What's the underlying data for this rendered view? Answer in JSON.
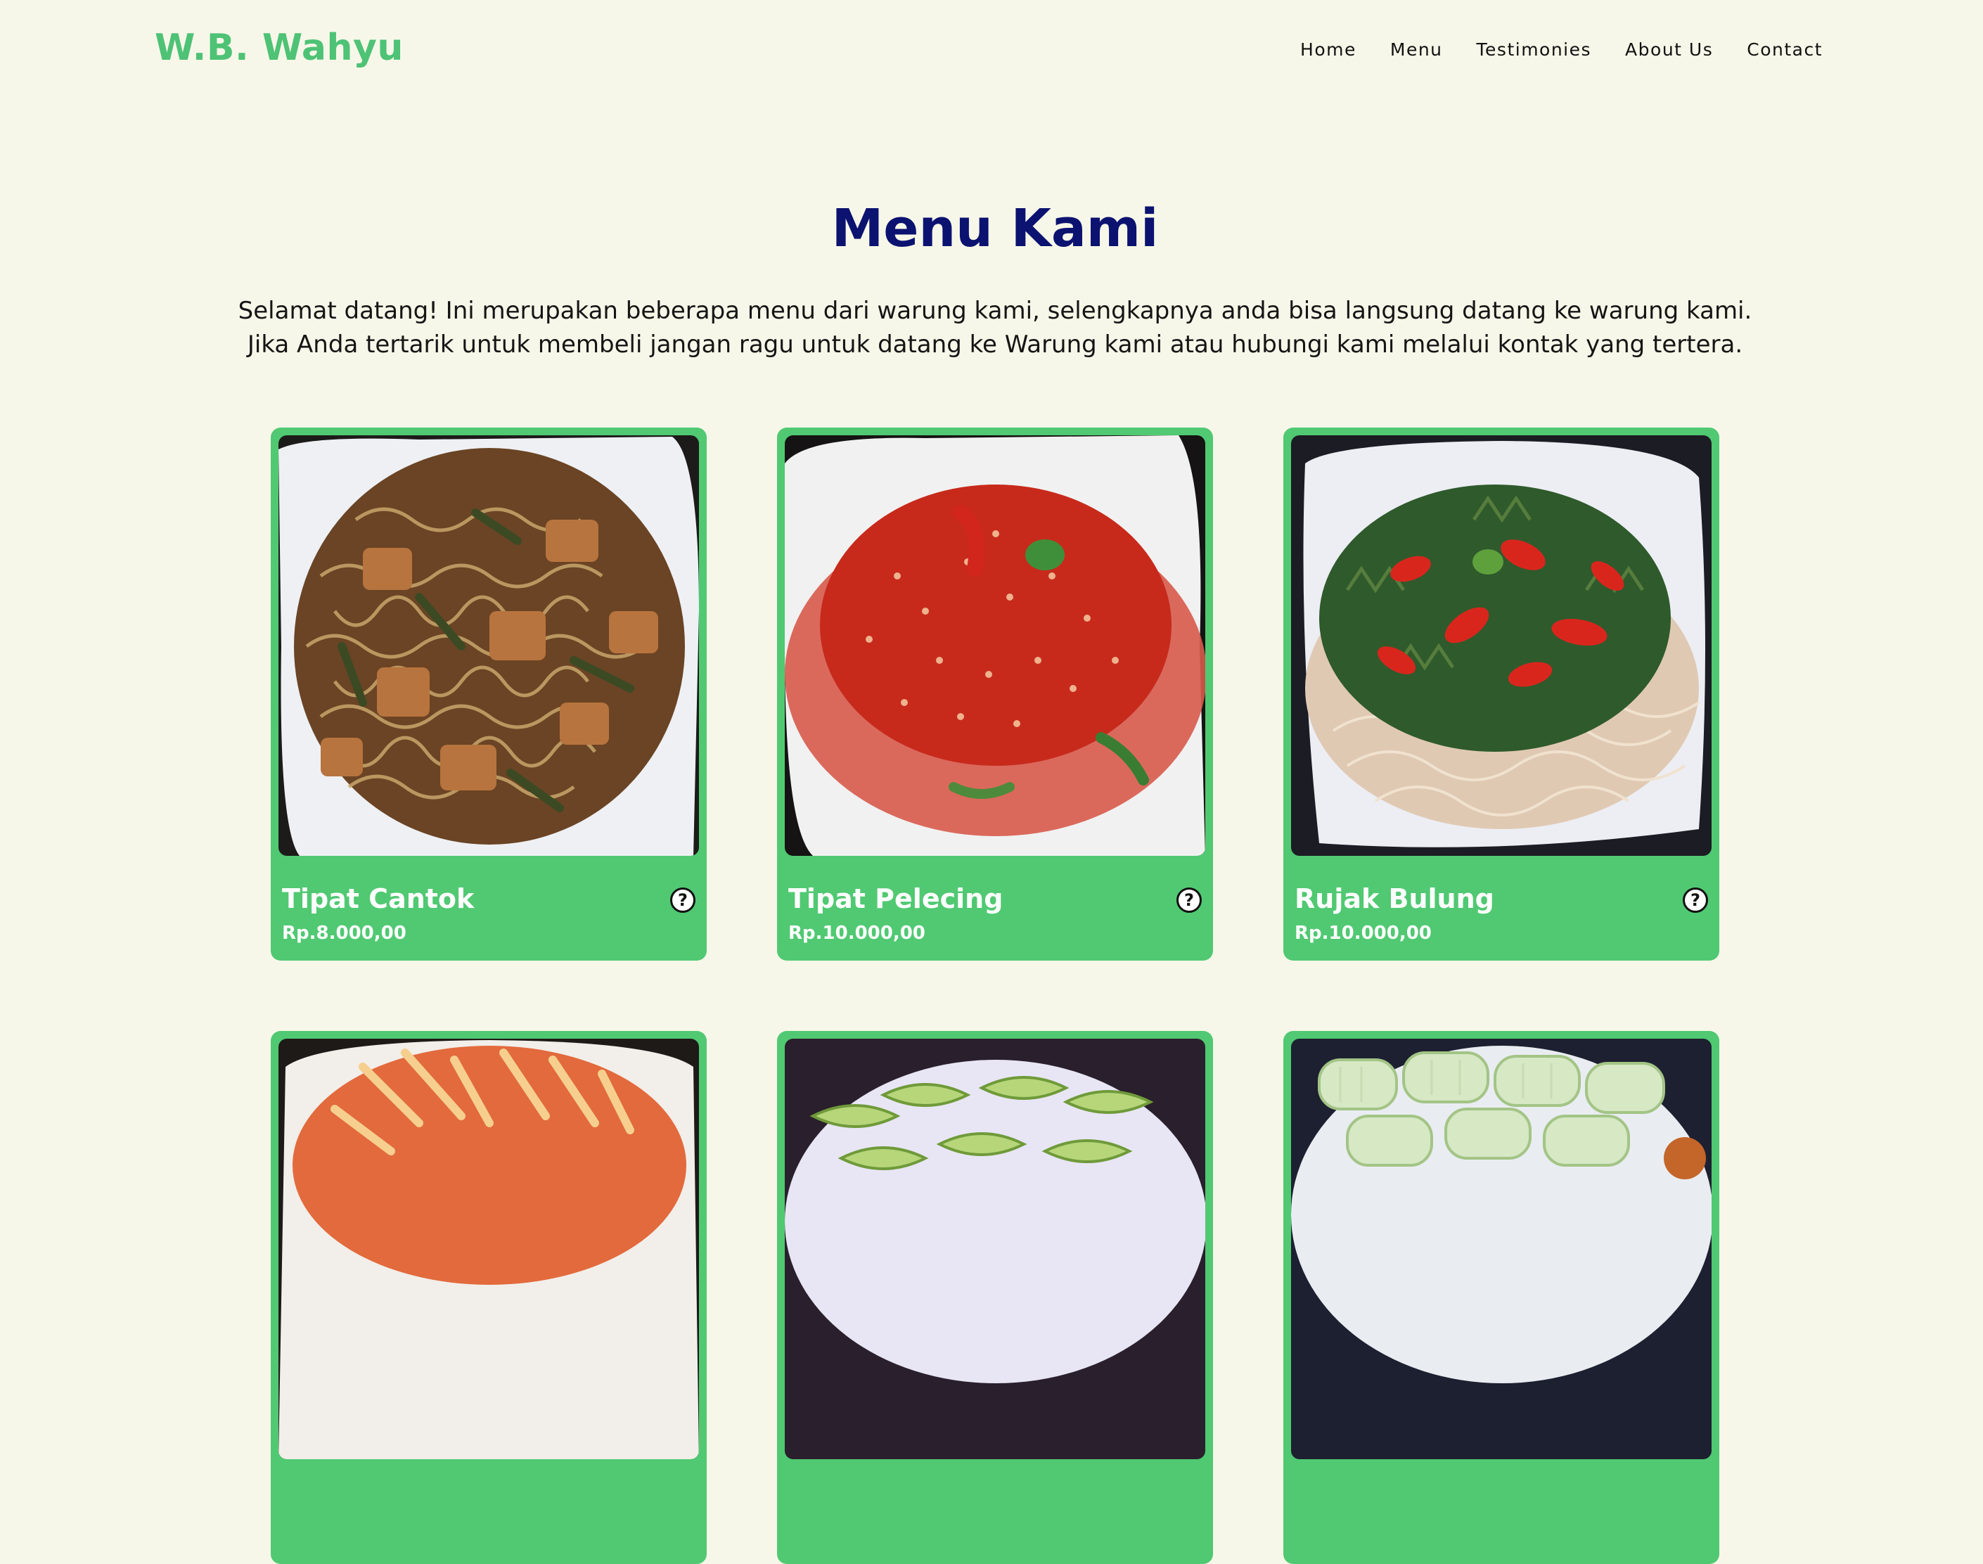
{
  "brand": "W.B. Wahyu",
  "nav": [
    "Home",
    "Menu",
    "Testimonies",
    "About Us",
    "Contact"
  ],
  "page": {
    "title": "Menu Kami",
    "intro": [
      "Selamat datang! Ini merupakan beberapa menu dari warung kami, selengkapnya anda bisa langsung datang ke warung kami.",
      "Jika Anda tertarik untuk membeli jangan ragu untuk datang ke Warung kami atau hubungi kami melalui kontak yang tertera."
    ]
  },
  "colors": {
    "brand": "#4ec275",
    "card": "#50c972",
    "title": "#0b1270",
    "background": "#f7f7e9"
  },
  "help_symbol": "?",
  "menu_items": [
    {
      "name": "Tipat Cantok",
      "price": "Rp.8.000,00",
      "photo": "tipat-cantok"
    },
    {
      "name": "Tipat Pelecing",
      "price": "Rp.10.000,00",
      "photo": "tipat-pelecing"
    },
    {
      "name": "Rujak Bulung",
      "price": "Rp.10.000,00",
      "photo": "rujak-bulung"
    },
    {
      "name": "",
      "price": "",
      "photo": "papaya-salad"
    },
    {
      "name": "",
      "price": "",
      "photo": "cucumber-slices"
    },
    {
      "name": "",
      "price": "",
      "photo": "sliced-fruit"
    }
  ]
}
